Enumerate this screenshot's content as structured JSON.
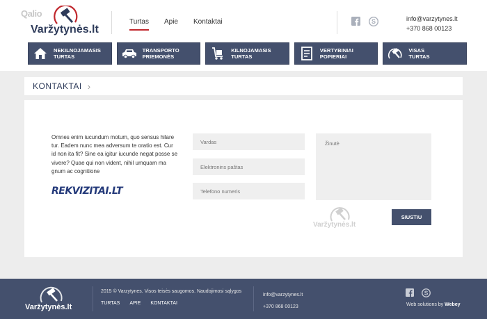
{
  "header": {
    "logo_ghost": "Qalio",
    "logo_text": "Varžytynės.lt",
    "nav": [
      {
        "label": "Turtas",
        "active": true
      },
      {
        "label": "Apie",
        "active": false
      },
      {
        "label": "Kontaktai",
        "active": false
      }
    ],
    "email": "info@varzytynes.lt",
    "phone": "+370 868 00123"
  },
  "categories": [
    {
      "label_1": "NEKILNOJAMASIS",
      "label_2": "TURTAS",
      "icon": "house-icon"
    },
    {
      "label_1": "TRANSPORTO",
      "label_2": "PRIEMONĖS",
      "icon": "car-icon"
    },
    {
      "label_1": "KILNOJAMASIS",
      "label_2": "TURTAS",
      "icon": "cart-icon"
    },
    {
      "label_1": "VERTYBINIAI",
      "label_2": "POPIERIAI",
      "icon": "document-icon"
    },
    {
      "label_1": "VISAS",
      "label_2": "TURTAS",
      "icon": "gavel-icon"
    }
  ],
  "breadcrumb": {
    "title": "KONTAKTAI"
  },
  "content": {
    "paragraph": "Omnes enim iucundum motum, quo sensus hilare tur. Eadem nunc mea adversum te oratio est. Cur id non ita fit? Sine ea igitur iucunde negat posse se vivere? Quae qui non vident, nihil umquam ma gnum ac cognitione",
    "partner_logo": "REKVIZITAI.LT",
    "watermark": "Varžytynės.lt"
  },
  "form": {
    "name_placeholder": "Vardas",
    "email_placeholder": "Elektronins paštas",
    "phone_placeholder": "Telefono numeris",
    "message_placeholder": "Žinutė",
    "submit_label": "SIUSTIU"
  },
  "footer": {
    "logo_text": "Varžytynės.lt",
    "copyright": "2015 © Varzytynes. Visos teisės saugomos. Naudojimosi sąlygos",
    "nav": [
      "TURTAS",
      "APIE",
      "KONTAKTAI"
    ],
    "email": "info@varzytynes.lt",
    "phone": "+370 868 00123",
    "credit_prefix": "Web solutions by",
    "credit_brand": "Webey"
  },
  "colors": {
    "navy": "#44506d",
    "accent_red": "#c0272d",
    "background": "#ededed"
  }
}
